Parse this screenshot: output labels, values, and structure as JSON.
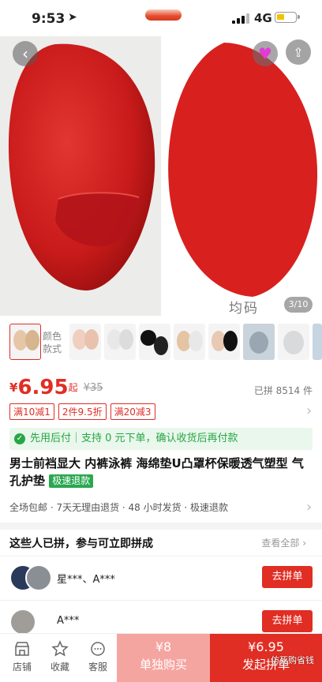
{
  "status_bar": {
    "time": "9:53",
    "network": "4G"
  },
  "gallery": {
    "size_label": "均码",
    "counter": "3/10"
  },
  "variants": {
    "label": "颜色\n款式"
  },
  "price": {
    "currency": "¥",
    "value": "6.95",
    "suffix": "起",
    "original": "¥35",
    "sold": "已拼 8514 件"
  },
  "coupons": [
    "满10减1",
    "2件9.5折",
    "满20减3"
  ],
  "bnpl": {
    "text": "先用后付｜支持 0 元下单，确认收货后再付款"
  },
  "product": {
    "title": "男士前裆显大 内裤泳裤 海绵垫U凸罩杯保暖透气塑型 气孔护垫",
    "badge": "极速退款"
  },
  "services": "全场包邮 · 7天无理由退货 · 48 小时发货 · 极速退款",
  "group_buy": {
    "heading": "这些人已拼，参与可立即拼成",
    "view_all": "查看全部",
    "rows": [
      {
        "names": "星***、A***",
        "button": "去拼单"
      },
      {
        "names": "A***",
        "button": "去拼单"
      }
    ]
  },
  "bottom_bar": {
    "tabs": [
      {
        "label": "店铺",
        "icon": "store-icon"
      },
      {
        "label": "收藏",
        "icon": "star-icon"
      },
      {
        "label": "客服",
        "icon": "chat-icon"
      }
    ],
    "buy_alone": {
      "price": "¥8",
      "label": "单独购买"
    },
    "buy_group": {
      "price": "¥6.95",
      "label": "发起拼单"
    }
  },
  "watermark": "仿死购省钱",
  "colors": {
    "accent": "#e02e24",
    "pad_red": "#d8201f",
    "green": "#27a644"
  }
}
